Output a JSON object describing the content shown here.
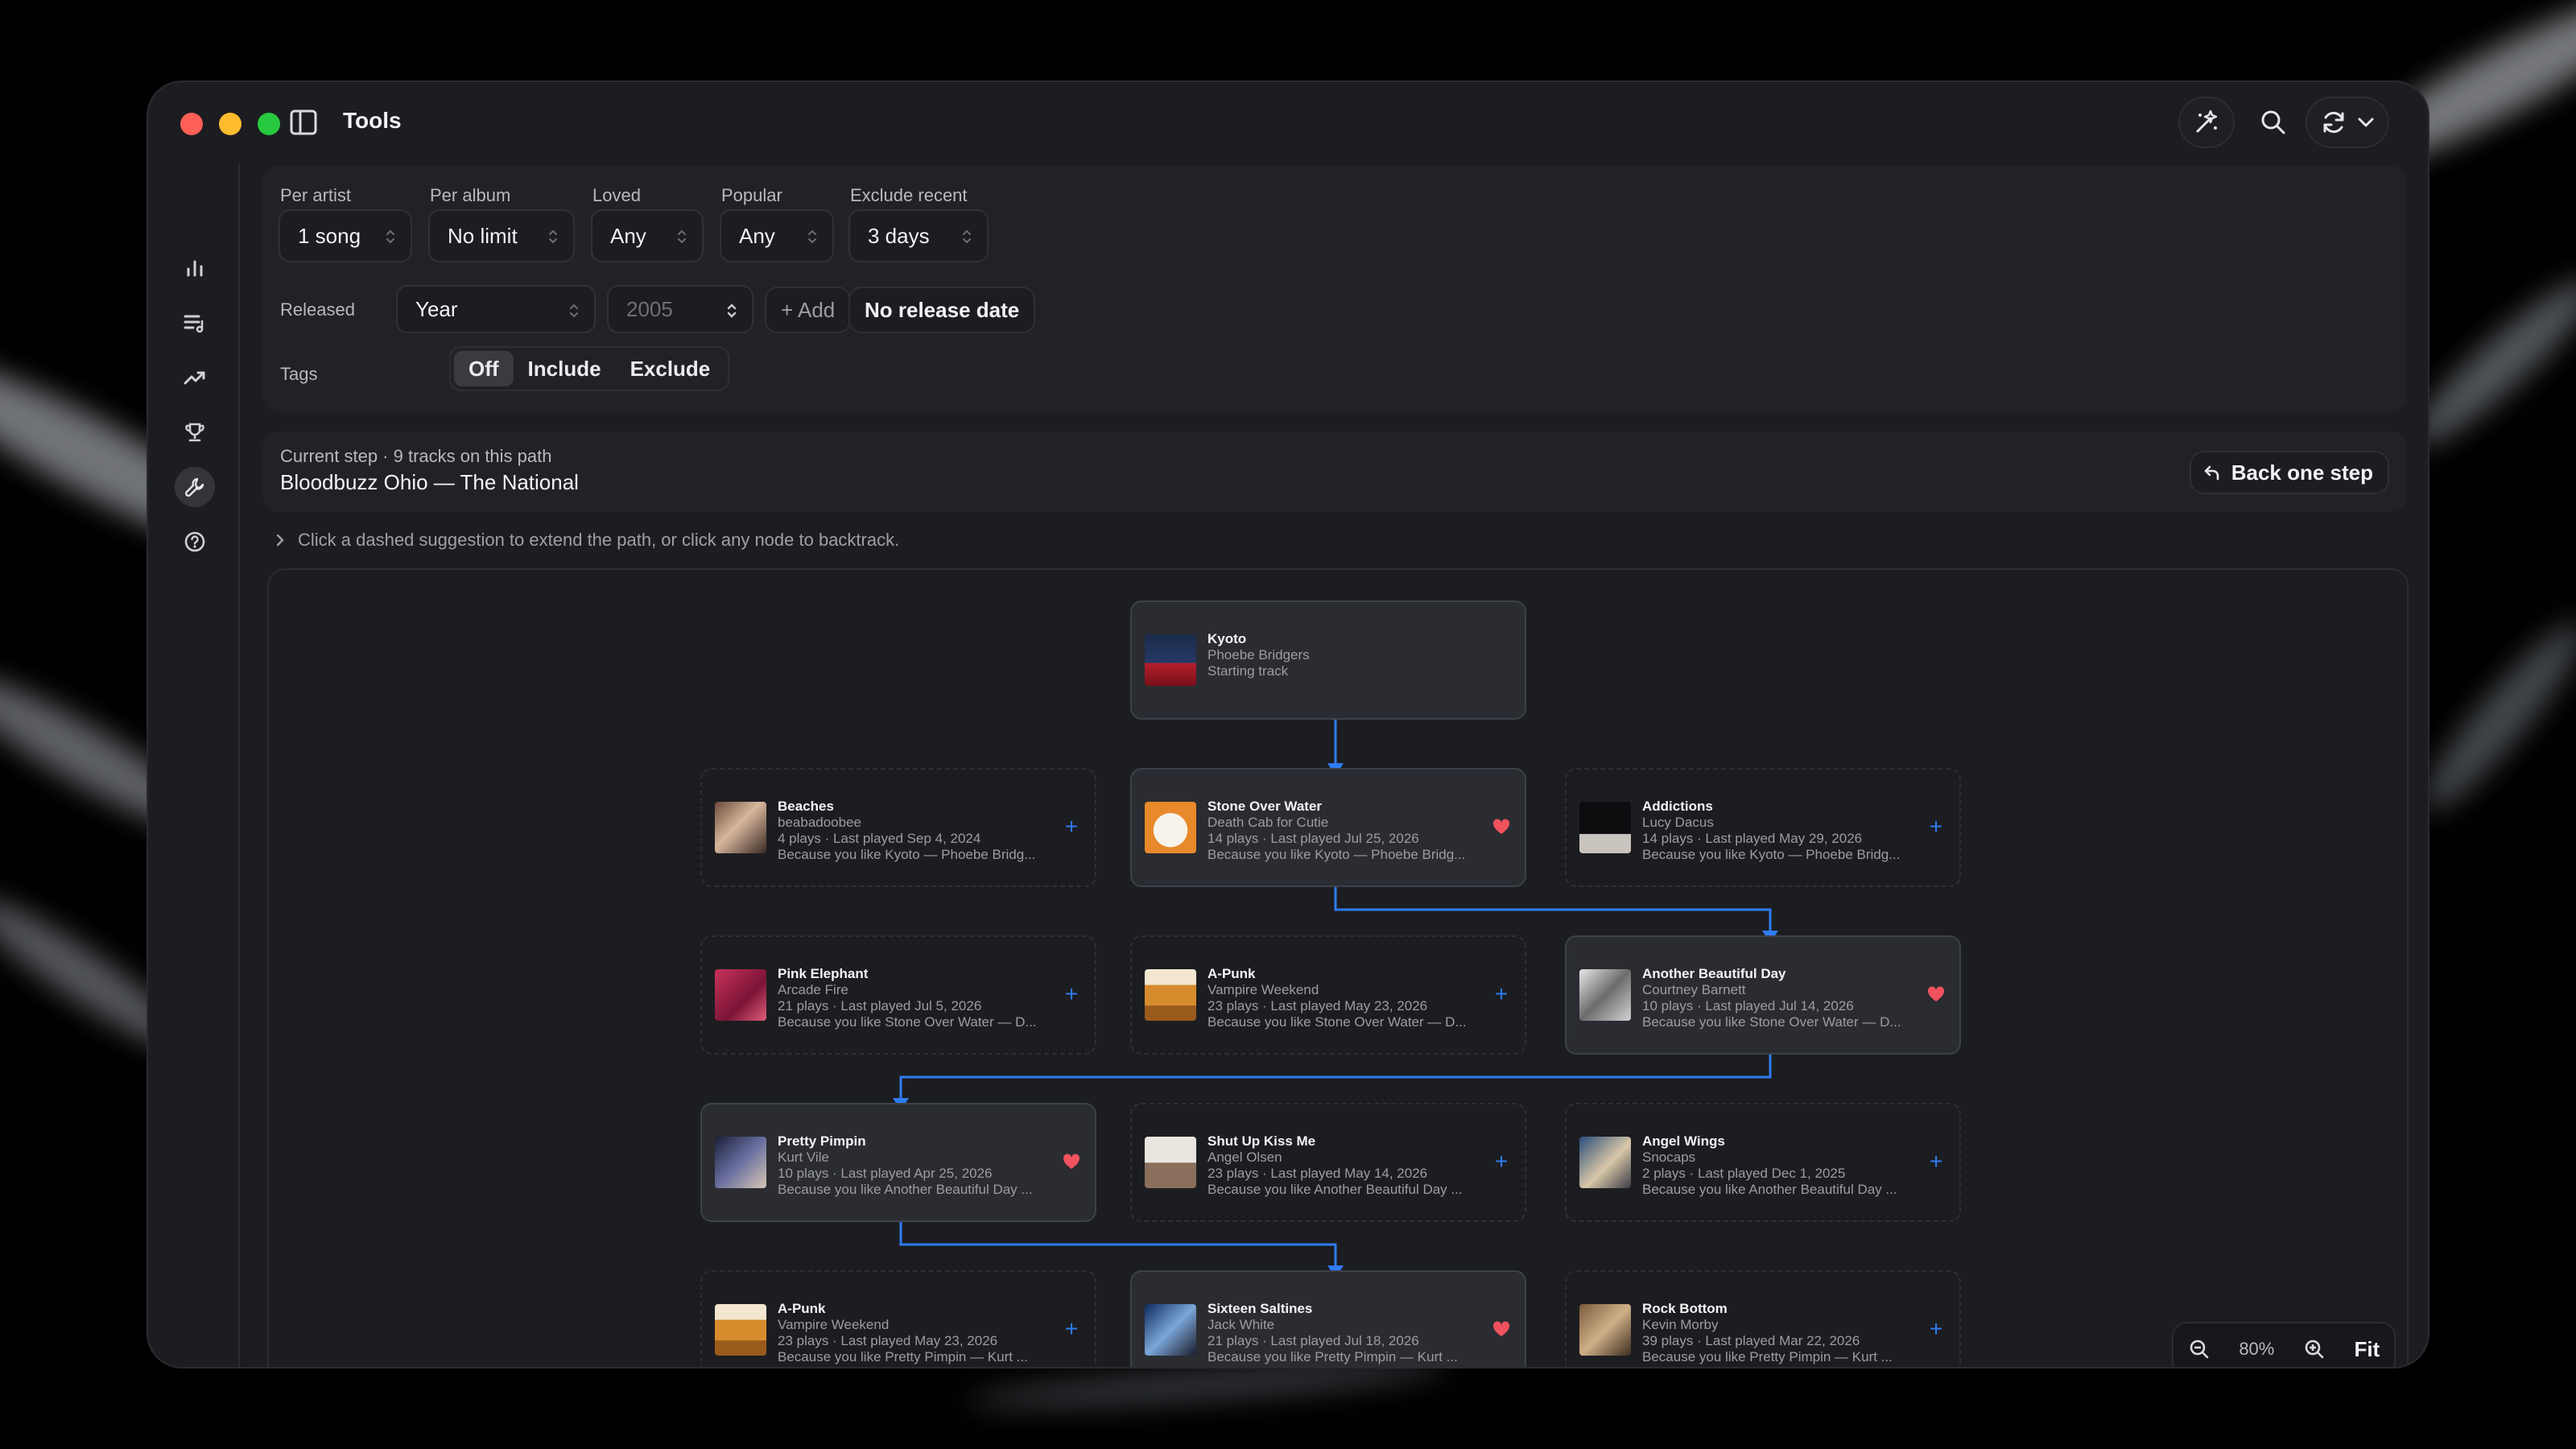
{
  "window": {
    "title": "Tools"
  },
  "filters": {
    "per_artist": {
      "label": "Per artist",
      "value": "1 song"
    },
    "per_album": {
      "label": "Per album",
      "value": "No limit"
    },
    "loved": {
      "label": "Loved",
      "value": "Any"
    },
    "popular": {
      "label": "Popular",
      "value": "Any"
    },
    "exclude_recent": {
      "label": "Exclude recent",
      "value": "3 days"
    },
    "released": {
      "label": "Released",
      "mode": "Year",
      "year_placeholder": "2005",
      "add_label": "+ Add",
      "no_date_label": "No release date"
    },
    "tags": {
      "label": "Tags",
      "options": [
        "Off",
        "Include",
        "Exclude"
      ],
      "selected": "Off"
    }
  },
  "current_step": {
    "subtitle": "Current step · 9 tracks on this path",
    "track": "Bloodbuzz Ohio — The National",
    "back_label": "Back one step"
  },
  "hint": "Click a dashed suggestion to extend the path, or click any node to backtrack.",
  "nodes": [
    {
      "title": "Kyoto",
      "artist": "Phoebe Bridgers",
      "line3": "Starting track",
      "line4": "",
      "selected": true,
      "action": ""
    },
    {
      "title": "Beaches",
      "artist": "beabadoobee",
      "line3": "4 plays · Last played Sep 4, 2024",
      "line4": "Because you like Kyoto — Phoebe Bridg...",
      "selected": false,
      "action": "+"
    },
    {
      "title": "Stone Over Water",
      "artist": "Death Cab for Cutie",
      "line3": "14 plays · Last played Jul 25, 2026",
      "line4": "Because you like Kyoto — Phoebe Bridg...",
      "selected": true,
      "action": "heart"
    },
    {
      "title": "Addictions",
      "artist": "Lucy Dacus",
      "line3": "14 plays · Last played May 29, 2026",
      "line4": "Because you like Kyoto — Phoebe Bridg...",
      "selected": false,
      "action": "+"
    },
    {
      "title": "Pink Elephant",
      "artist": "Arcade Fire",
      "line3": "21 plays · Last played Jul 5, 2026",
      "line4": "Because you like Stone Over Water — D...",
      "selected": false,
      "action": "+"
    },
    {
      "title": "A-Punk",
      "artist": "Vampire Weekend",
      "line3": "23 plays · Last played May 23, 2026",
      "line4": "Because you like Stone Over Water — D...",
      "selected": false,
      "action": "+"
    },
    {
      "title": "Another Beautiful Day",
      "artist": "Courtney Barnett",
      "line3": "10 plays · Last played Jul 14, 2026",
      "line4": "Because you like Stone Over Water — D...",
      "selected": true,
      "action": "heart"
    },
    {
      "title": "Pretty Pimpin",
      "artist": "Kurt Vile",
      "line3": "10 plays · Last played Apr 25, 2026",
      "line4": "Because you like Another Beautiful Day ...",
      "selected": true,
      "action": "heart"
    },
    {
      "title": "Shut Up Kiss Me",
      "artist": "Angel Olsen",
      "line3": "23 plays · Last played May 14, 2026",
      "line4": "Because you like Another Beautiful Day ...",
      "selected": false,
      "action": "+"
    },
    {
      "title": "Angel Wings",
      "artist": "Snocaps",
      "line3": "2 plays · Last played Dec 1, 2025",
      "line4": "Because you like Another Beautiful Day ...",
      "selected": false,
      "action": "+"
    },
    {
      "title": "A-Punk",
      "artist": "Vampire Weekend",
      "line3": "23 plays · Last played May 23, 2026",
      "line4": "Because you like Pretty Pimpin — Kurt ...",
      "selected": false,
      "action": "+"
    },
    {
      "title": "Sixteen Saltines",
      "artist": "Jack White",
      "line3": "21 plays · Last played Jul 18, 2026",
      "line4": "Because you like Pretty Pimpin — Kurt ...",
      "selected": true,
      "action": "heart"
    },
    {
      "title": "Rock Bottom",
      "artist": "Kevin Morby",
      "line3": "39 plays · Last played Mar 22, 2026",
      "line4": "Because you like Pretty Pimpin — Kurt ...",
      "selected": false,
      "action": "+"
    }
  ],
  "zoom": {
    "level": "80%",
    "fit_label": "Fit"
  },
  "colors": {
    "accent": "#2f7bf2",
    "heart": "#f0525d",
    "window_bg": "#1c1d21",
    "panel_bg": "#212226"
  }
}
